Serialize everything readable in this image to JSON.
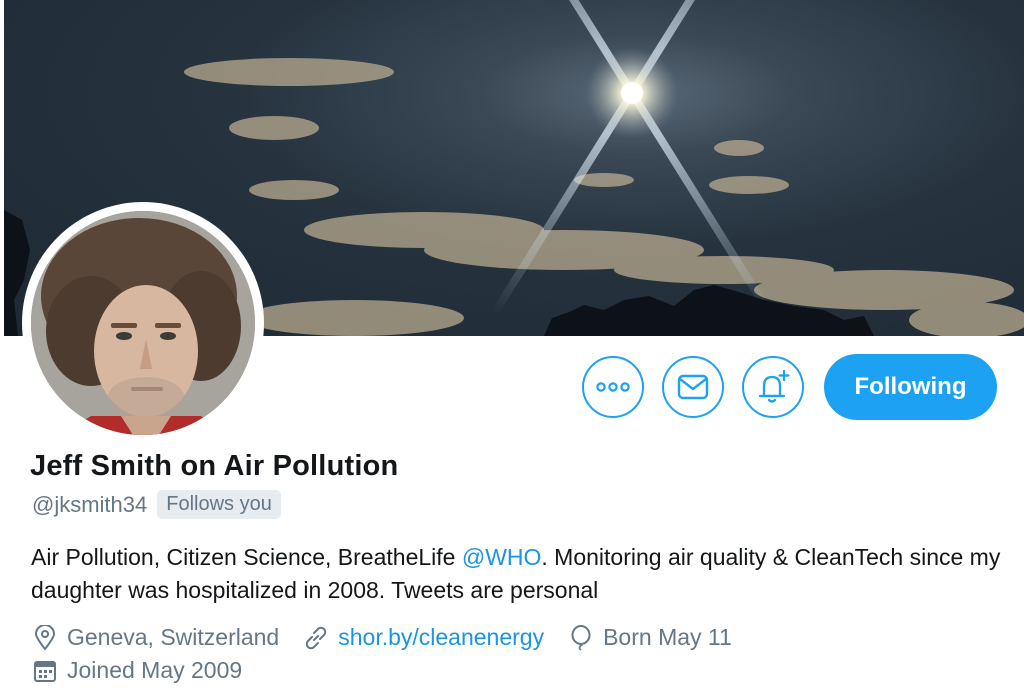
{
  "profile": {
    "display_name": "Jeff Smith on Air Pollution",
    "handle": "@jksmith34",
    "follows_you": "Follows you",
    "bio_before": "Air Pollution, Citizen Science, BreatheLife ",
    "bio_mention": "@WHO",
    "bio_after": ". Monitoring air quality & CleanTech since my daughter was hospitalized in 2008. Tweets are personal",
    "location": "Geneva, Switzerland",
    "website": "shor.by/cleanenergy",
    "birthday": "Born May 11",
    "joined": "Joined May 2009"
  },
  "actions": {
    "more": "more-icon",
    "message": "mail-icon",
    "notify": "bell-plus-icon",
    "following_label": "Following"
  },
  "icons": {
    "location": "location-pin-icon",
    "website": "link-icon",
    "birthday": "balloon-icon",
    "joined": "calendar-icon"
  },
  "colors": {
    "accent": "#1da1f2",
    "link": "#1b95e0",
    "muted": "#657786",
    "badge_bg": "#e6ecf0"
  }
}
